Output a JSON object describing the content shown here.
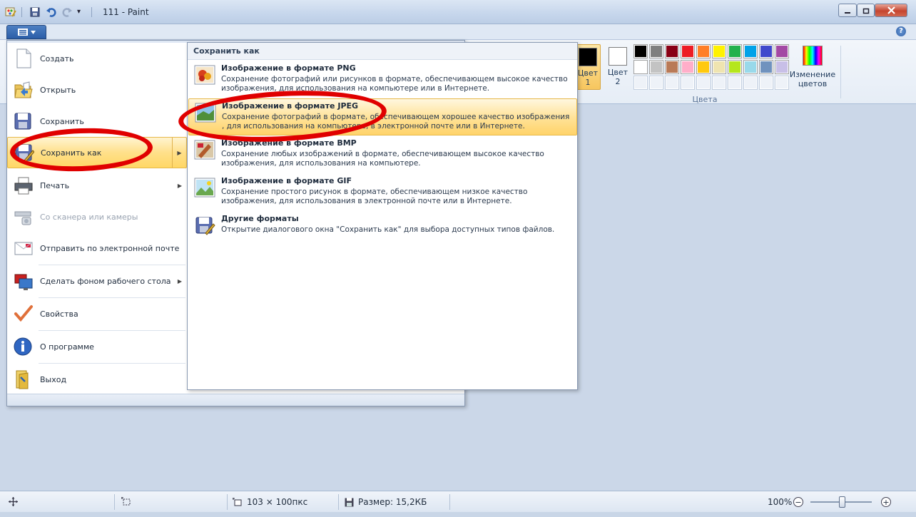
{
  "window": {
    "title": "111 - Paint",
    "quick_access_dropdown": "▾"
  },
  "ribbon": {
    "help_glyph": "?",
    "color1": {
      "label": "Цвет 1",
      "line1": "Цвет",
      "line2": "1",
      "swatch": "#000000"
    },
    "color2": {
      "label": "Цвет 2",
      "line1": "Цвет",
      "line2": "2",
      "swatch": "#ffffff"
    },
    "palette_row1": [
      "#000000",
      "#7f7f7f",
      "#880015",
      "#ed1c24",
      "#ff7f27",
      "#fff200",
      "#22b14c",
      "#00a2e8",
      "#3f48cc",
      "#a349a4"
    ],
    "palette_row2": [
      "#ffffff",
      "#c3c3c3",
      "#b97a57",
      "#ffaec9",
      "#ffc90e",
      "#efe4b0",
      "#b5e61d",
      "#99d9ea",
      "#7092be",
      "#c8bfe7"
    ],
    "edit_colors_line1": "Изменение",
    "edit_colors_line2": "цветов",
    "colors_group": "Цвета"
  },
  "app_menu": {
    "items": [
      {
        "label": "Создать",
        "icon": "new-file-icon"
      },
      {
        "label": "Открыть",
        "icon": "open-folder-icon"
      },
      {
        "label": "Сохранить",
        "icon": "save-icon"
      },
      {
        "label": "Сохранить как",
        "icon": "save-as-icon",
        "arrow": "▶"
      },
      {
        "label": "Печать",
        "icon": "print-icon",
        "arrow": "▶"
      },
      {
        "label": "Со сканера или камеры",
        "icon": "scanner-icon"
      },
      {
        "label": "Отправить по электронной почте",
        "icon": "email-icon"
      },
      {
        "label": "Сделать фоном рабочего стола",
        "icon": "desktop-icon",
        "arrow": "▶"
      },
      {
        "label": "Свойства",
        "icon": "checkmark-icon"
      },
      {
        "label": "О программе",
        "icon": "info-icon"
      },
      {
        "label": "Выход",
        "icon": "exit-icon"
      }
    ]
  },
  "save_as_submenu": {
    "title": "Сохранить как",
    "items": [
      {
        "heading": "Изображение в формате PNG",
        "desc": "Сохранение фотографий или рисунков в формате, обеспечивающем высокое качество изображения, для использования на компьютере или в Интернете."
      },
      {
        "heading": "Изображение в формате JPEG",
        "desc": "Сохранение фотографий в формате, обеспечивающем хорошее качество изображения , для использования на компьютере, в электронной почте или в Интернете."
      },
      {
        "heading": "Изображение в формате BMP",
        "desc": "Сохранение любых изображений в формате, обеспечивающем высокое качество изображения, для использования на компьютере."
      },
      {
        "heading": "Изображение в формате GIF",
        "desc": "Сохранение простого рисунок в формате, обеспечивающем низкое качество изображения, для использования в электронной почте или в Интернете."
      },
      {
        "heading": "Другие форматы",
        "desc": "Открытие диалогового окна \"Сохранить как\" для выбора доступных типов файлов."
      }
    ]
  },
  "statusbar": {
    "dimensions": "103 × 100пкс",
    "size": "Размер: 15,2КБ",
    "zoom": "100%",
    "zoom_out": "−",
    "zoom_in": "+"
  }
}
